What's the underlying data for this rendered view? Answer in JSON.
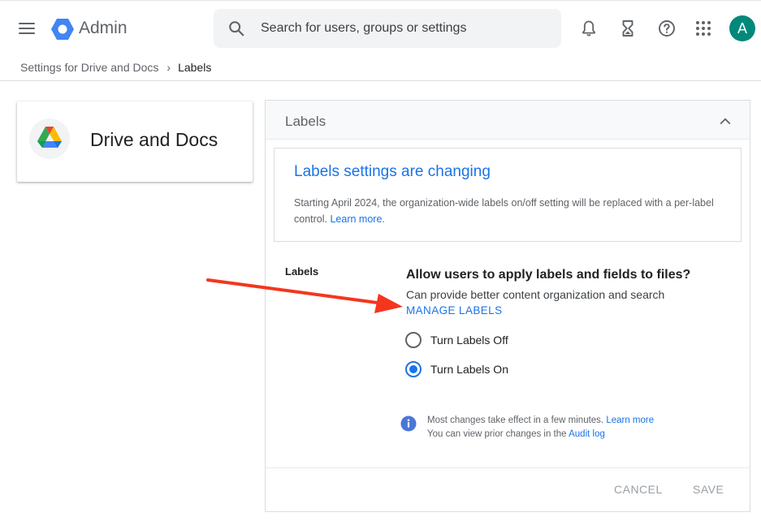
{
  "header": {
    "app_name": "Admin",
    "search_placeholder": "Search for users, groups or settings",
    "avatar_initial": "A"
  },
  "breadcrumb": {
    "parent": "Settings for Drive and Docs",
    "separator": "›",
    "current": "Labels"
  },
  "app_card": {
    "title": "Drive and Docs"
  },
  "panel": {
    "title": "Labels",
    "notice": {
      "title": "Labels settings are changing",
      "body": "Starting April 2024, the organization-wide labels on/off setting will be replaced with a per-label control.",
      "link": "Learn more",
      "period": "."
    },
    "setting": {
      "label": "Labels",
      "question": "Allow users to apply labels and fields to files?",
      "description": "Can provide better content organization and search",
      "manage_link": "MANAGE LABELS",
      "options": [
        {
          "label": "Turn Labels Off",
          "selected": false
        },
        {
          "label": "Turn Labels On",
          "selected": true
        }
      ]
    },
    "info": {
      "line1": "Most changes take effect in a few minutes.",
      "line1_link": "Learn more",
      "line2": "You can view prior changes in the",
      "line2_link": "Audit log"
    },
    "footer": {
      "cancel_label": "CANCEL",
      "save_label": "SAVE"
    }
  },
  "colors": {
    "accent": "#1a73e8",
    "avatar": "#00897b",
    "annotation_arrow": "#f4361e"
  },
  "icons": [
    "menu-icon",
    "admin-logo-icon",
    "search-icon",
    "bell-icon",
    "hourglass-icon",
    "help-icon",
    "apps-grid-icon",
    "drive-logo-icon",
    "chevron-up-icon",
    "info-icon"
  ]
}
